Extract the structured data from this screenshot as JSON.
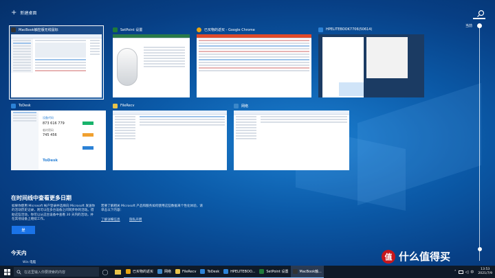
{
  "new_desktop": {
    "plus": "+",
    "label": "新建桌面"
  },
  "timeline": {
    "label": "当前"
  },
  "windows": [
    {
      "title": "MacBook触控版无线鼠标",
      "icon_color": "#333333"
    },
    {
      "title": "SetPoint 设置",
      "icon_color": "#1f7a3a"
    },
    {
      "title": "已买物的返买 - Google Chrome",
      "icon_color": "#e8a412"
    },
    {
      "title": "HPELITEBOOK7706(50614)",
      "icon_color": "#2c82d6"
    },
    {
      "title": "ToDesk",
      "icon_color": "#2c82d6"
    },
    {
      "title": "FileRecv",
      "icon_color": "#e8c34a"
    },
    {
      "title": "网络",
      "icon_color": "#3c87c8"
    }
  ],
  "todesk": {
    "id_label": "设备代码",
    "id": "873 616 779",
    "pw_label": "临时密码",
    "pw": "745 456",
    "brand": "ToDesk"
  },
  "timeline_prompt": {
    "title": "在时间线中查看更多日期",
    "text_left": "如果你使用 Microsoft 帐户登录并选择向 Microsoft 发送你的活动历史记录，则可以在多台设备之间同步你的活动。借助这些活动，你可以从这台设备中查看 30 天内的活动，并在其他设备上继续工作。",
    "text_right": "若要了解相关 Microsoft 产品和服务如何使用这些数据来个性化体验，请单击以下内容：",
    "link_more": "了解详细信息",
    "link_privacy": "隐私声明",
    "yes": "是"
  },
  "today": {
    "title": "今天内",
    "items": "Win 电脑"
  },
  "taskbar": {
    "search_placeholder": "在这里输入你要搜索的内容",
    "apps": [
      {
        "label": "已买物的返买",
        "icon_color": "#e8a412",
        "active": false
      },
      {
        "label": "网络",
        "icon_color": "#3c87c8",
        "active": false
      },
      {
        "label": "FileRecv",
        "icon_color": "#e8c34a",
        "active": false
      },
      {
        "label": "ToDesk",
        "icon_color": "#2c82d6",
        "active": false
      },
      {
        "label": "HPELITEBOO...",
        "icon_color": "#2c82d6",
        "active": false
      },
      {
        "label": "SetPoint 设置",
        "icon_color": "#1f7a3a",
        "active": false
      },
      {
        "label": "MacBook触...",
        "icon_color": "#333333",
        "active": true
      }
    ],
    "tray_icons": [
      "chevron-up-icon",
      "network-icon",
      "volume-icon",
      "ime-icon"
    ],
    "time": "13:53",
    "date": "2021/7/9"
  },
  "watermark": {
    "badge": "值",
    "text": "什么值得买"
  }
}
